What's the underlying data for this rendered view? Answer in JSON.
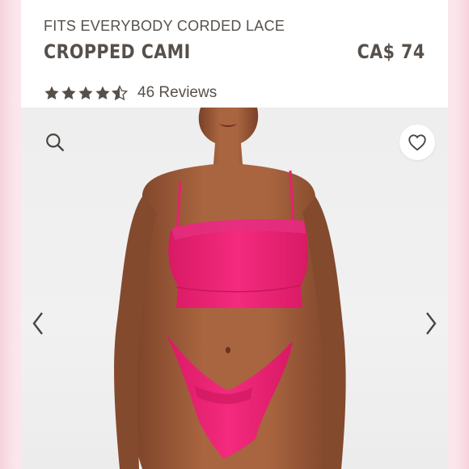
{
  "product": {
    "collection": "FITS EVERYBODY CORDED LACE",
    "title": "CROPPED CAMI",
    "price": "CA$ 74",
    "rating": 4.5,
    "reviews_label": "46 Reviews"
  },
  "gallery": {
    "image_description_icon": "product-photo",
    "zoom_icon": "search-icon",
    "favorite_icon": "heart-icon",
    "prev_icon": "chevron-left-icon",
    "next_icon": "chevron-right-icon"
  },
  "colors": {
    "text": "#57504a",
    "product_pink": "#f0247a",
    "skin": "#9b5a3a",
    "background_pink": "#fbe6ec"
  }
}
